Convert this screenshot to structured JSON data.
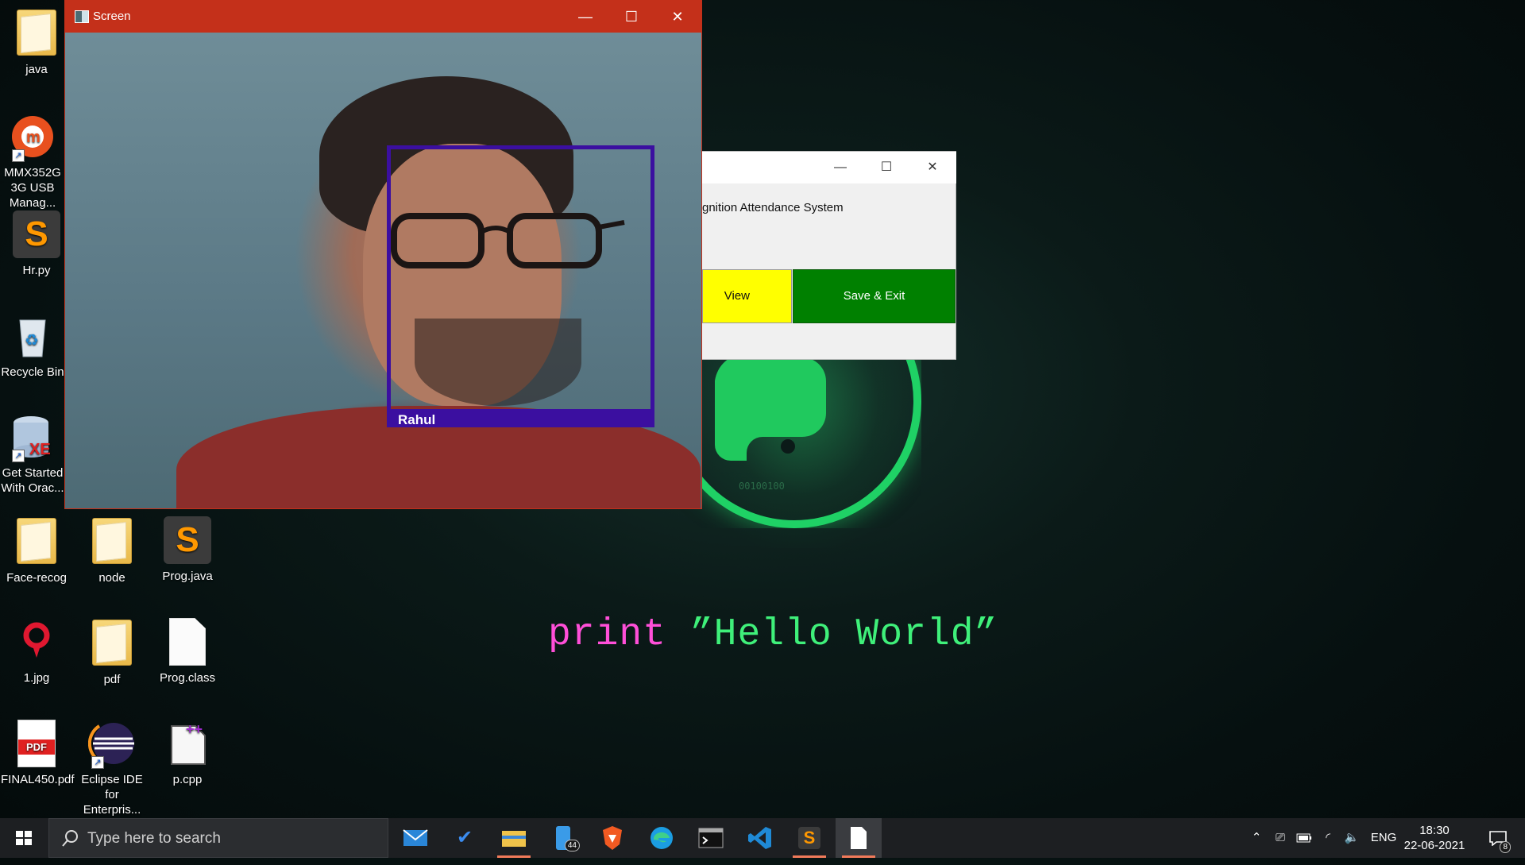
{
  "desktop": {
    "icons": [
      {
        "label": "java"
      },
      {
        "label": "MMX352G 3G USB Manag..."
      },
      {
        "label": "Hr.py"
      },
      {
        "label": "Recycle Bin"
      },
      {
        "label": "Get Started With Orac..."
      },
      {
        "label": "Face-recog"
      },
      {
        "label": "node"
      },
      {
        "label": "Prog.java"
      },
      {
        "label": "1.jpg"
      },
      {
        "label": "pdf"
      },
      {
        "label": "Prog.class"
      },
      {
        "label": "FINAL450.pdf"
      },
      {
        "label": "Eclipse IDE for Enterpris..."
      },
      {
        "label": "p.cpp"
      }
    ]
  },
  "wallpaper": {
    "code_keyword": "print",
    "code_string": " ”Hello World”",
    "binary_text": "00100100",
    "accent_color": "#1fd165"
  },
  "camera_window": {
    "title": "Screen",
    "detected_name": "Rahul",
    "box_color": "#3b0fa0",
    "titlebar_color": "#c4301a"
  },
  "attendance_window": {
    "heading": "gnition Attendance System",
    "view_button": "View",
    "save_button": "Save & Exit"
  },
  "taskbar": {
    "search_placeholder": "Type here to search",
    "mail_badge": "44",
    "language": "ENG",
    "time": "18:30",
    "date": "22-06-2021",
    "notification_count": "8"
  }
}
